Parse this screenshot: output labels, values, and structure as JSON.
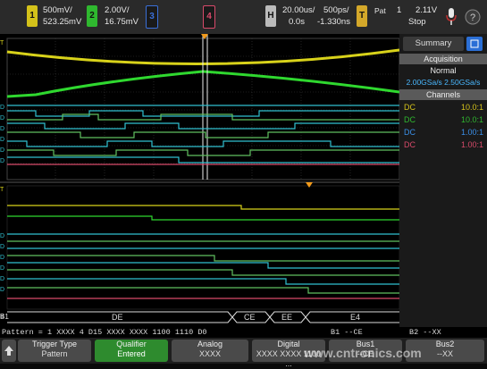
{
  "top": {
    "ch1": {
      "num": "1",
      "scale": "500mV/",
      "offset": "523.25mV",
      "color": "#d4c21a"
    },
    "ch2": {
      "num": "2",
      "scale": "2.00V/",
      "offset": "16.75mV",
      "color": "#2fb82f"
    },
    "ch3": {
      "num": "3",
      "color": "#3a6fd8"
    },
    "ch4": {
      "num": "4",
      "color": "#d84a6a"
    },
    "horiz": {
      "label": "H",
      "time_div": "20.00us/",
      "sample": "500ps/",
      "delay": "0.0s",
      "delay2": "-1.330ns"
    },
    "trig": {
      "label": "T",
      "mode": "Pat",
      "num": "1",
      "level": "2.11V",
      "state": "Stop"
    }
  },
  "summary": {
    "tab": "Summary",
    "acq_header": "Acquisition",
    "acq_mode": "Normal",
    "acq_rates": "2.00GSa/s  2.50GSa/s",
    "channels_header": "Channels",
    "channels": [
      {
        "coupling": "DC",
        "probe": "10.0:1",
        "color": "#d4c21a"
      },
      {
        "coupling": "DC",
        "probe": "10.0:1",
        "color": "#2fb82f"
      },
      {
        "coupling": "DC",
        "probe": "1.00:1",
        "color": "#3a8fe8"
      },
      {
        "coupling": "DC",
        "probe": "1.00:1",
        "color": "#d84a6a"
      }
    ]
  },
  "bus": {
    "label": "B1",
    "segments": [
      "DE",
      "CE",
      "EE",
      "E4"
    ]
  },
  "status": {
    "pattern": "Pattern = 1 XXXX 4 D15 XXXX XXXX 1100 1110 D0",
    "b1": "B1 --CE",
    "b2": "B2 --XX"
  },
  "softkeys": [
    {
      "line1": "Trigger Type",
      "line2": "Pattern"
    },
    {
      "line1": "Qualifier",
      "line2": "Entered"
    },
    {
      "line1": "Analog",
      "line2": "XXXX"
    },
    {
      "line1": "Digital",
      "line2": "XXXX XXXX 1100 ..."
    },
    {
      "line1": "Bus1",
      "line2": "--CE"
    },
    {
      "line1": "Bus2",
      "line2": "--XX"
    }
  ],
  "watermark": "www.cntronics.com"
}
